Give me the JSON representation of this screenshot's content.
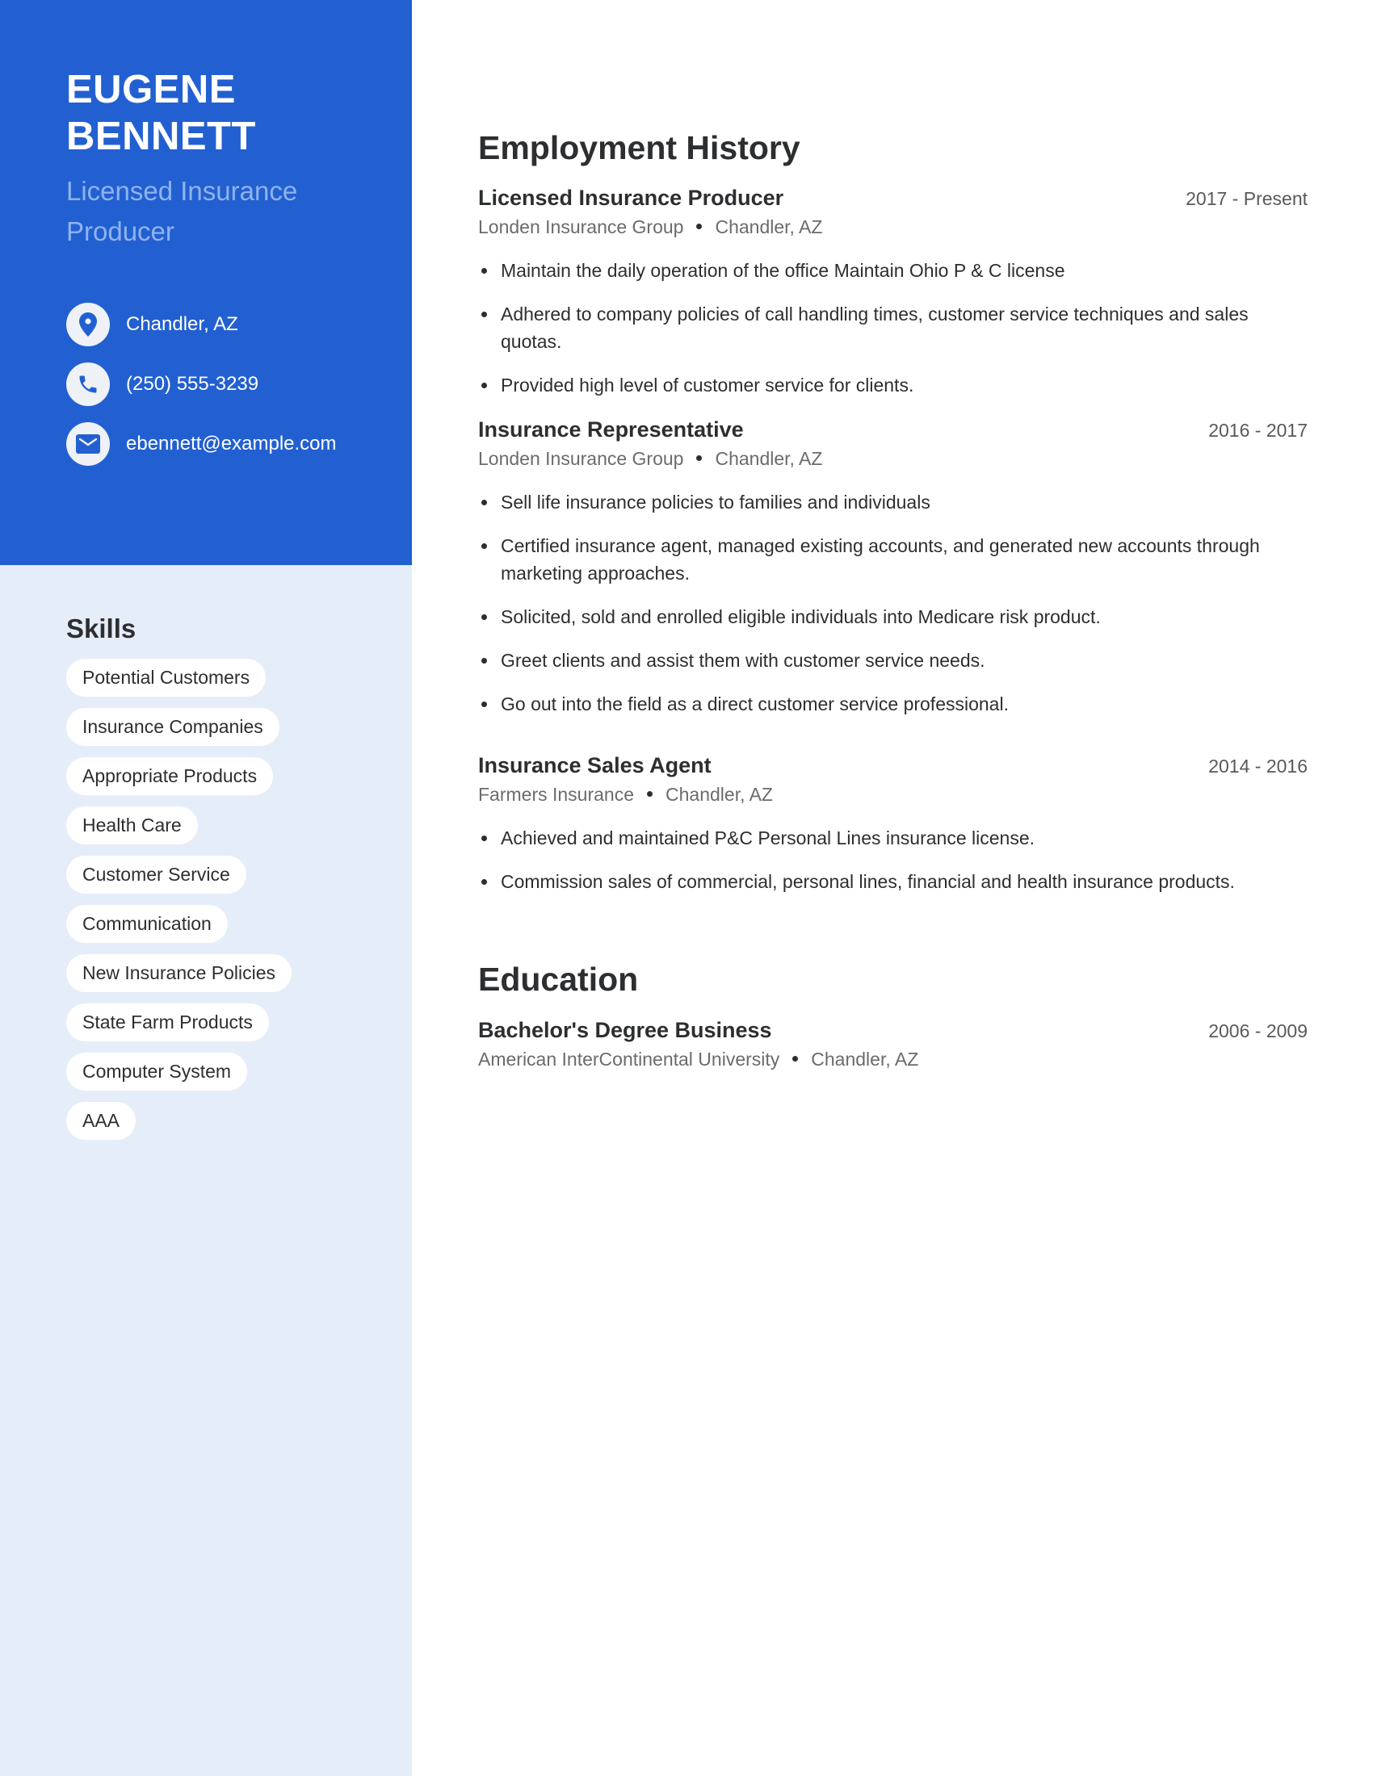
{
  "profile": {
    "name_line1": "EUGENE",
    "name_line2": "BENNETT",
    "title": "Licensed Insurance Producer"
  },
  "contact": [
    {
      "icon": "location-pin-icon",
      "text": "Chandler, AZ"
    },
    {
      "icon": "phone-icon",
      "text": "(250) 555-3239"
    },
    {
      "icon": "envelope-icon",
      "text": "ebennett@example.com"
    }
  ],
  "skills": {
    "heading": "Skills",
    "items": [
      "Potential Customers",
      "Insurance Companies",
      "Appropriate Products",
      "Health Care",
      "Customer Service",
      "Communication",
      "New Insurance Policies",
      "State Farm Products",
      "Computer System",
      "AAA"
    ]
  },
  "employment": {
    "heading": "Employment History",
    "jobs": [
      {
        "title": "Licensed Insurance Producer",
        "dates": "2017 - Present",
        "company": "Londen Insurance Group",
        "location": "Chandler, AZ",
        "bullets": [
          "Maintain the daily operation of the office Maintain Ohio P & C license",
          "Adhered to company policies of call handling times, customer service techniques and sales quotas.",
          "Provided high level of customer service for clients."
        ]
      },
      {
        "title": "Insurance Representative",
        "dates": "2016 - 2017",
        "company": "Londen Insurance Group",
        "location": "Chandler, AZ",
        "bullets": [
          "Sell life insurance policies to families and individuals",
          "Certified insurance agent, managed existing accounts, and generated new accounts through marketing approaches.",
          "Solicited, sold and enrolled eligible individuals into Medicare risk product.",
          "Greet clients and assist them with customer service needs.",
          "Go out into the field as a direct customer service professional."
        ]
      },
      {
        "title": "Insurance Sales Agent",
        "dates": "2014 - 2016",
        "company": "Farmers Insurance",
        "location": "Chandler, AZ",
        "bullets": [
          "Achieved and maintained P&C Personal Lines insurance license.",
          "Commission sales of commercial, personal lines, financial and health insurance products."
        ]
      }
    ]
  },
  "education": {
    "heading": "Education",
    "entries": [
      {
        "degree": "Bachelor's Degree Business",
        "dates": "2006 - 2009",
        "school": "American InterContinental University",
        "location": "Chandler, AZ"
      }
    ]
  },
  "colors": {
    "accent": "#2260d1",
    "sidebar_light": "#e5edf9",
    "subtitle": "#8fb3ee",
    "text": "#2d2e30",
    "muted": "#6a6b6d"
  }
}
